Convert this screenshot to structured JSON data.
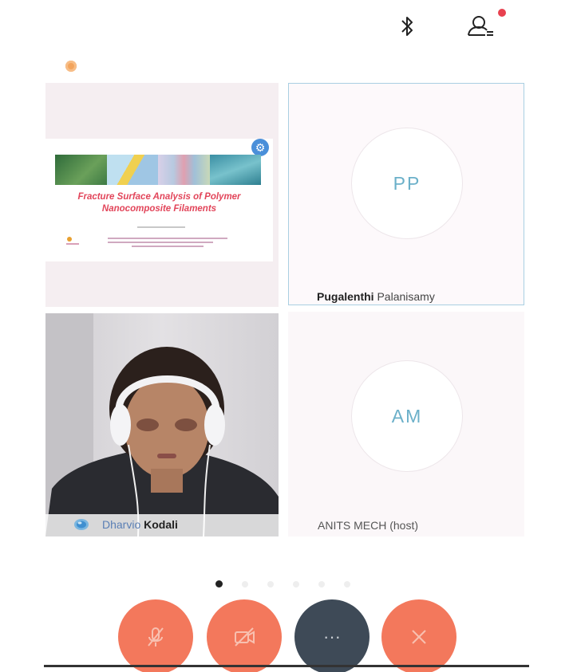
{
  "topbar": {
    "bluetooth_icon": "bluetooth-icon",
    "participants_icon": "participants-icon",
    "notification_color": "#e8414f"
  },
  "recording_indicator_color": "#f3a45c",
  "tiles": {
    "screen_share": {
      "slide_title_line1": "Fracture Surface Analysis of Polymer",
      "slide_title_line2": "Nanocomposite Filaments"
    },
    "participant_pp": {
      "initials": "PP",
      "name_first": "Pugalenthi",
      "name_last": "Palanisamy"
    },
    "participant_video": {
      "name_first": "Dharvio",
      "name_last": "Kodali"
    },
    "participant_am": {
      "initials": "AM",
      "name": "ANITS MECH (host)"
    }
  },
  "pager": {
    "pages": 6,
    "active": 1
  },
  "controls": {
    "mute_icon": "mic-off-icon",
    "video_icon": "video-off-icon",
    "more_label": "···",
    "end_icon": "close-icon",
    "accent_color": "#f3785c",
    "more_color": "#3e4a57"
  }
}
